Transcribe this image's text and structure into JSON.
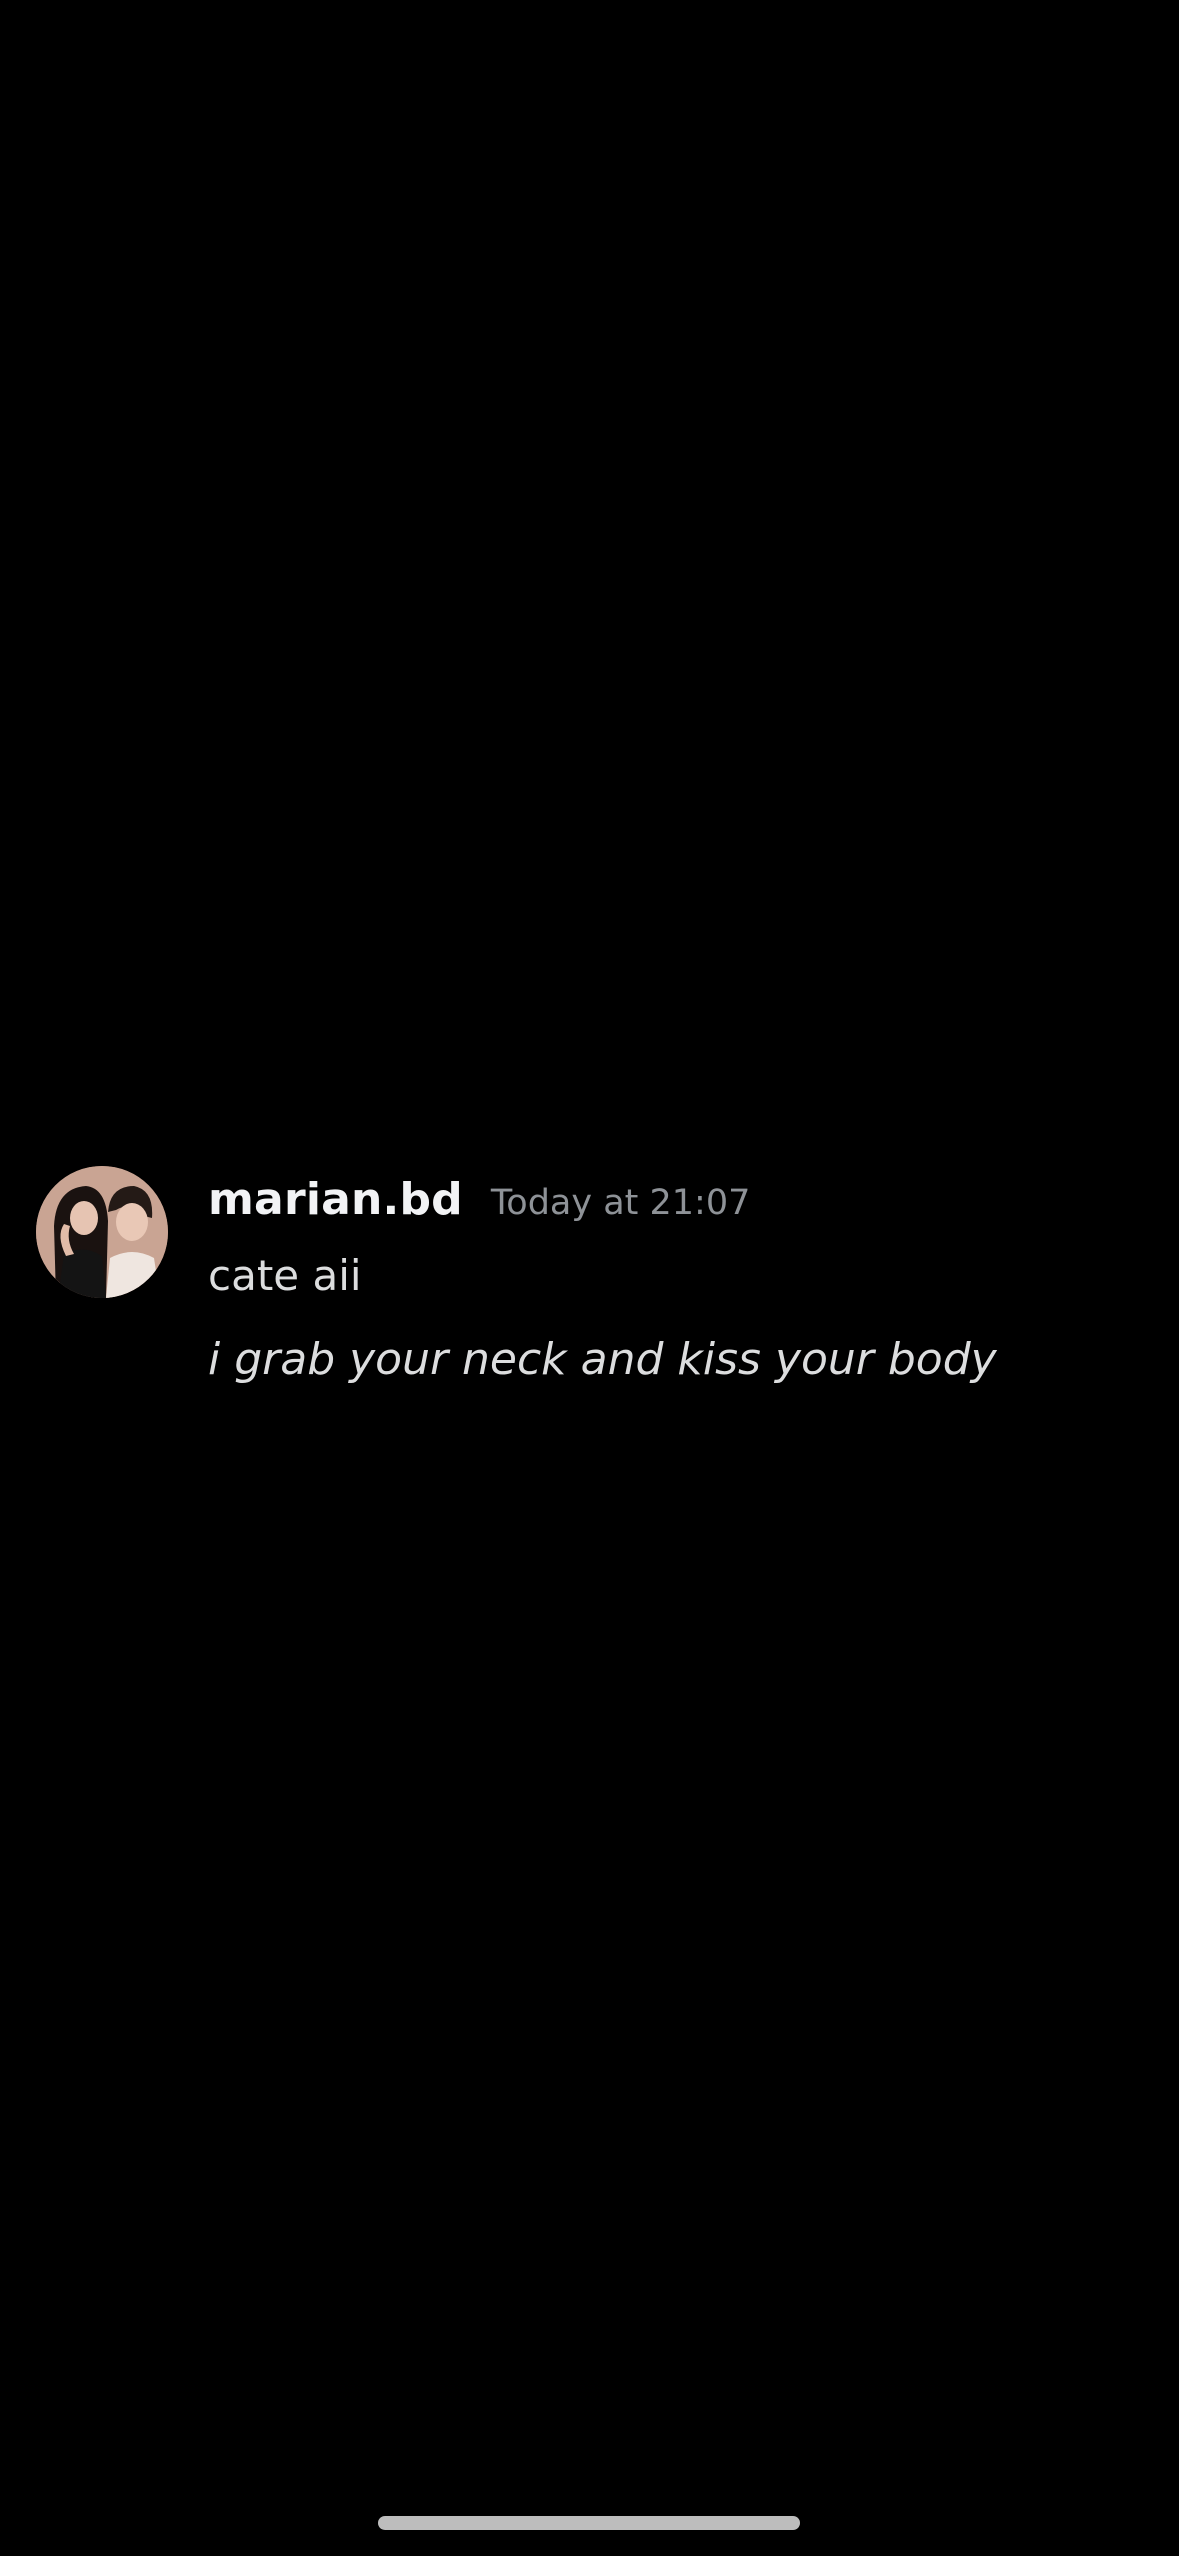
{
  "message": {
    "author": "marian.bd",
    "timestamp": "Today at 21:07",
    "lines": [
      "cate aii",
      "i grab your neck and kiss your body"
    ],
    "avatar_icon": "user-avatar-photo"
  },
  "colors": {
    "background": "#000000",
    "username": "#f2f3f5",
    "timestamp": "#8e9297",
    "text": "#dcddde",
    "home_indicator": "#bdbdbd"
  }
}
